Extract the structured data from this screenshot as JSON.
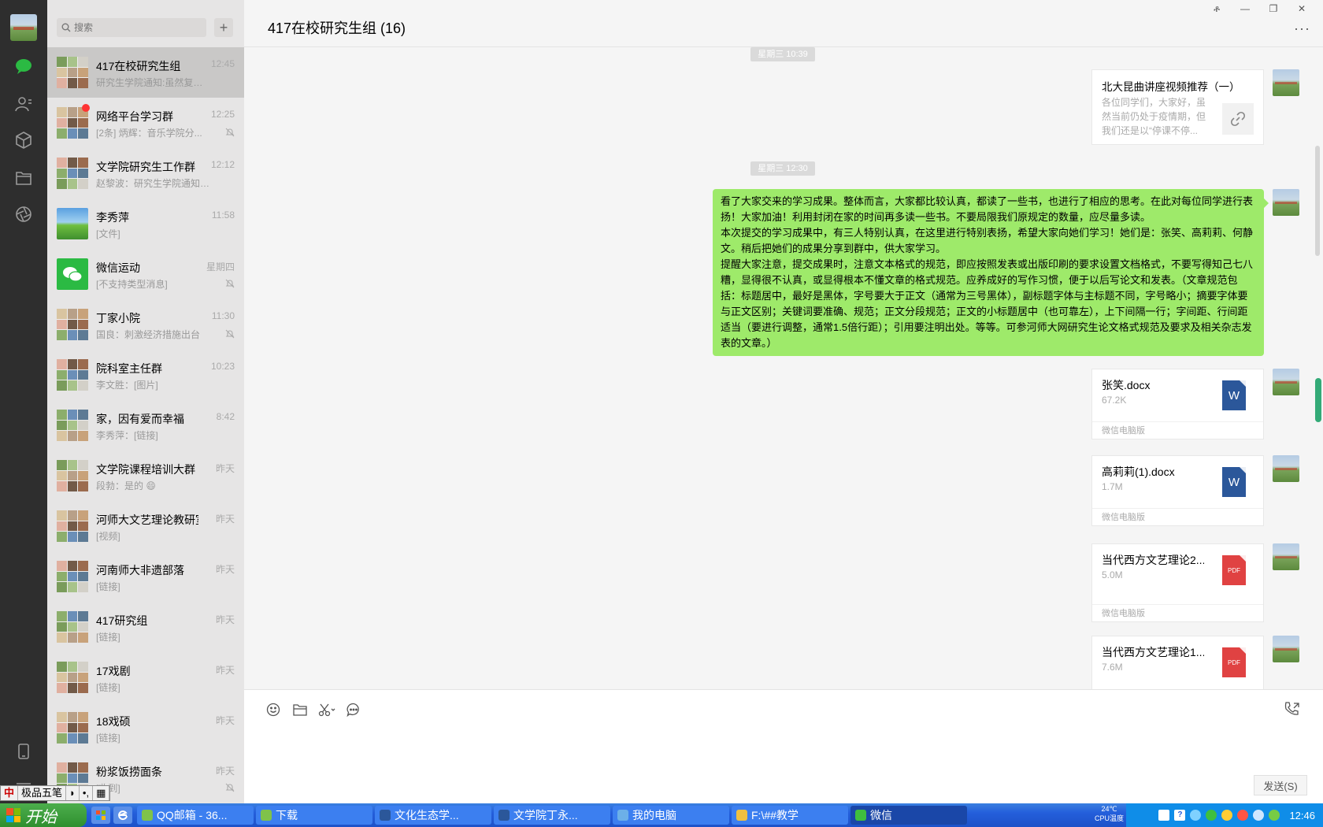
{
  "search": {
    "placeholder": "搜索"
  },
  "conversations": [
    {
      "name": "417在校研究生组",
      "time": "12:45",
      "preview": "研究生学院通知:虽然复工..."
    },
    {
      "name": "网络平台学习群",
      "time": "12:25",
      "preview": "[2条] 炳辉：音乐学院分..."
    },
    {
      "name": "文学院研究生工作群",
      "time": "12:12",
      "preview": "赵黎波：研究生学院通知:..."
    },
    {
      "name": "李秀萍",
      "time": "11:58",
      "preview": "[文件]"
    },
    {
      "name": "微信运动",
      "time": "星期四",
      "preview": "[不支持类型消息]"
    },
    {
      "name": "丁家小院",
      "time": "11:30",
      "preview": "国良：刺激经济措施出台"
    },
    {
      "name": "院科室主任群",
      "time": "10:23",
      "preview": "李文胜：[图片]"
    },
    {
      "name": "家，因有爱而幸福",
      "time": "8:42",
      "preview": "李秀萍：[链接]"
    },
    {
      "name": "文学院课程培训大群",
      "time": "昨天",
      "preview": "段勃：是的 😄"
    },
    {
      "name": "河师大文艺理论教研室",
      "time": "昨天",
      "preview": "[视频]"
    },
    {
      "name": "河南师大非遗部落",
      "time": "昨天",
      "preview": "[链接]"
    },
    {
      "name": "417研究组",
      "time": "昨天",
      "preview": "[链接]"
    },
    {
      "name": "17戏剧",
      "time": "昨天",
      "preview": "[链接]"
    },
    {
      "name": "18戏硕",
      "time": "昨天",
      "preview": "[链接]"
    },
    {
      "name": "粉浆饭捞面条",
      "time": "昨天",
      "preview": "[收到]"
    }
  ],
  "chat": {
    "title": "417在校研究生组 (16)",
    "more": "···",
    "timestamps": [
      "星期三 10:39",
      "星期三 12:30"
    ],
    "link_card": {
      "title": "北大昆曲讲座视频推荐（一）",
      "desc": "各位同学们，大家好，虽然当前仍处于疫情期，但我们还是以“停课不停..."
    },
    "text_message": [
      "看了大家交来的学习成果。整体而言，大家都比较认真，都读了一些书，也进行了相应的思考。在此对每位同学进行表扬！大家加油！利用封闭在家的时间再多读一些书。不要局限我们原规定的数量，应尽量多读。",
      "本次提交的学习成果中，有三人特别认真，在这里进行特别表扬，希望大家向她们学习！她们是：张笑、高莉莉、何静文。稍后把她们的成果分享到群中，供大家学习。",
      "提醒大家注意，提交成果时，注意文本格式的规范，即应按照发表或出版印刷的要求设置文档格式，不要写得知己七八糟，显得很不认真，或显得根本不懂文章的格式规范。应养成好的写作习惯，便于以后写论文和发表。（文章规范包括：标题居中，最好是黑体，字号要大于正文（通常为三号黑体），副标题字体与主标题不同，字号略小；摘要字体要与正文区别；关键词要准确、规范；正文分段规范；正文的小标题居中（也可靠左），上下间隔一行；字间距、行间距适当（要进行调整，通常1.5倍行距）；引用要注明出处。等等。可参河师大网研究生论文格式规范及要求及相关杂志发表的文章。）"
    ],
    "files": [
      {
        "name": "张笑.docx",
        "size": "67.2K",
        "type": "W",
        "footer": "微信电脑版"
      },
      {
        "name": "高莉莉(1).docx",
        "size": "1.7M",
        "type": "W",
        "footer": "微信电脑版"
      },
      {
        "name": "当代西方文艺理论2....",
        "size": "5.0M",
        "type": "PDF",
        "footer": "微信电脑版"
      },
      {
        "name": "当代西方文艺理论1....",
        "size": "7.6M",
        "type": "PDF",
        "footer": ""
      }
    ],
    "send_label": "发送(S)"
  },
  "window_buttons": [
    "ቶ",
    "—",
    "❐",
    "✕"
  ],
  "ime": [
    "中",
    "极品五笔",
    "◗",
    "•,",
    "▦"
  ],
  "taskbar": {
    "start_label": "开始",
    "tasks": [
      {
        "label": "QQ邮箱 - 36...",
        "color": "#7fc24a"
      },
      {
        "label": "下载",
        "color": "#7fc24a"
      },
      {
        "label": "文化生态学...",
        "color": "#2b579a"
      },
      {
        "label": "文学院丁永...",
        "color": "#2b579a"
      },
      {
        "label": "我的电脑",
        "color": "#6cb0e8"
      },
      {
        "label": "F:\\##教学",
        "color": "#f0c040"
      },
      {
        "label": "微信",
        "color": "#3fbf3f"
      }
    ],
    "cpu_temp": "24℃",
    "cpu_label": "CPU温度",
    "clock": "12:46"
  },
  "colors": {
    "bubble": "#9eea6a",
    "wechat_green": "#2bba43",
    "taskbar_blue": "#245edb"
  }
}
